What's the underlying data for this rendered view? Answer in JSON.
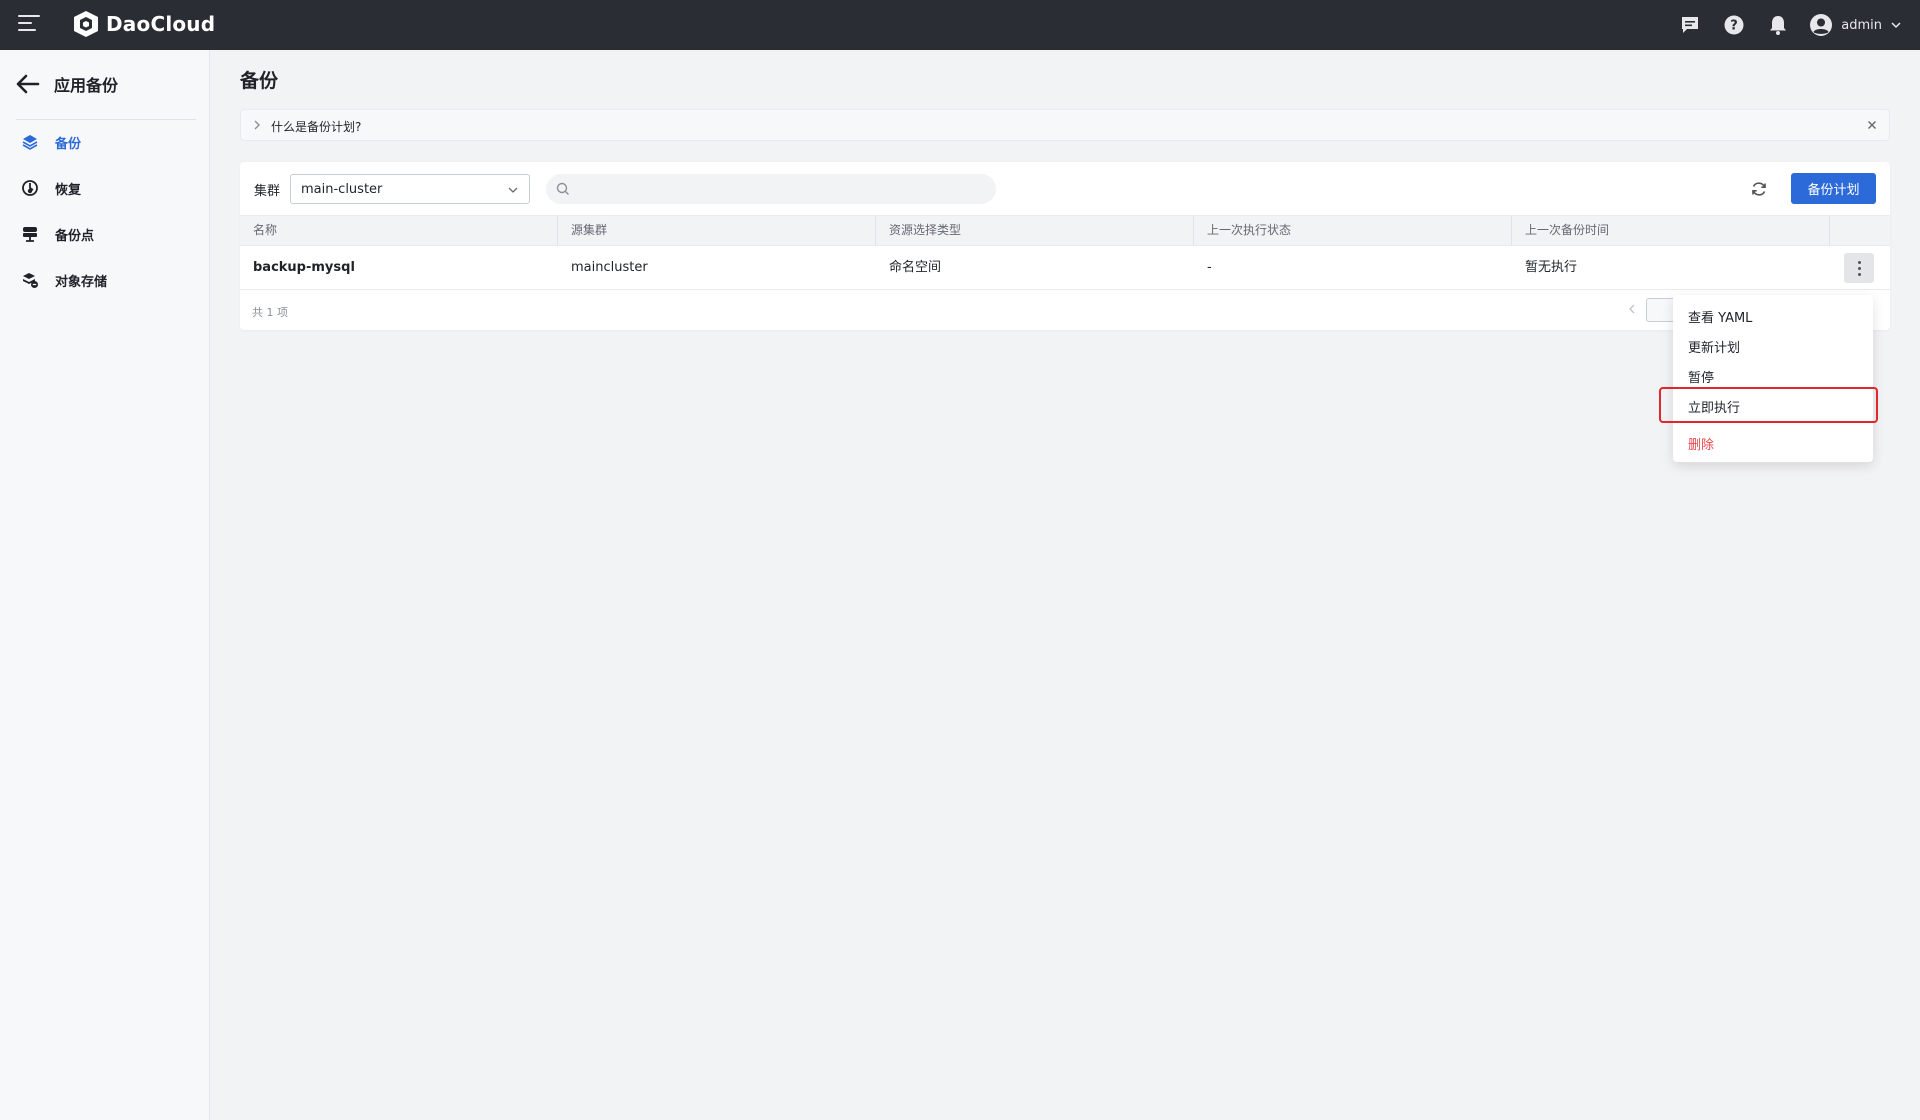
{
  "header": {
    "brand": "DaoCloud",
    "user_name": "admin",
    "colors": {
      "bar_bg": "#2a2d33",
      "accent": "#2c6ad9"
    },
    "icons": [
      "menu-icon",
      "message-icon",
      "help-icon",
      "bell-icon",
      "user-icon",
      "chevron-down-icon"
    ]
  },
  "sidebar": {
    "title": "应用备份",
    "items": [
      {
        "label": "备份",
        "icon": "layers-icon",
        "active": true
      },
      {
        "label": "恢复",
        "icon": "restore-icon",
        "active": false
      },
      {
        "label": "备份点",
        "icon": "server-icon",
        "active": false
      },
      {
        "label": "对象存储",
        "icon": "storage-icon",
        "active": false
      }
    ]
  },
  "main": {
    "title": "备份",
    "info_text": "什么是备份计划?",
    "cluster_label": "集群",
    "cluster_value": "main-cluster",
    "search_placeholder": "",
    "create_button": "备份计划",
    "table": {
      "columns": [
        "名称",
        "源集群",
        "资源选择类型",
        "上一次执行状态",
        "上一次备份时间"
      ],
      "rows": [
        {
          "name": "backup-mysql",
          "source_cluster": "maincluster",
          "resource_type": "命名空间",
          "last_status": "-",
          "last_backup_time": "暂无执行"
        }
      ]
    },
    "total_text": "共 1 项"
  },
  "dropdown": {
    "items": [
      "查看 YAML",
      "更新计划",
      "暂停",
      "立即执行"
    ],
    "danger_item": "删除",
    "highlighted_item": "立即执行",
    "highlight_color": "#e2262d"
  }
}
